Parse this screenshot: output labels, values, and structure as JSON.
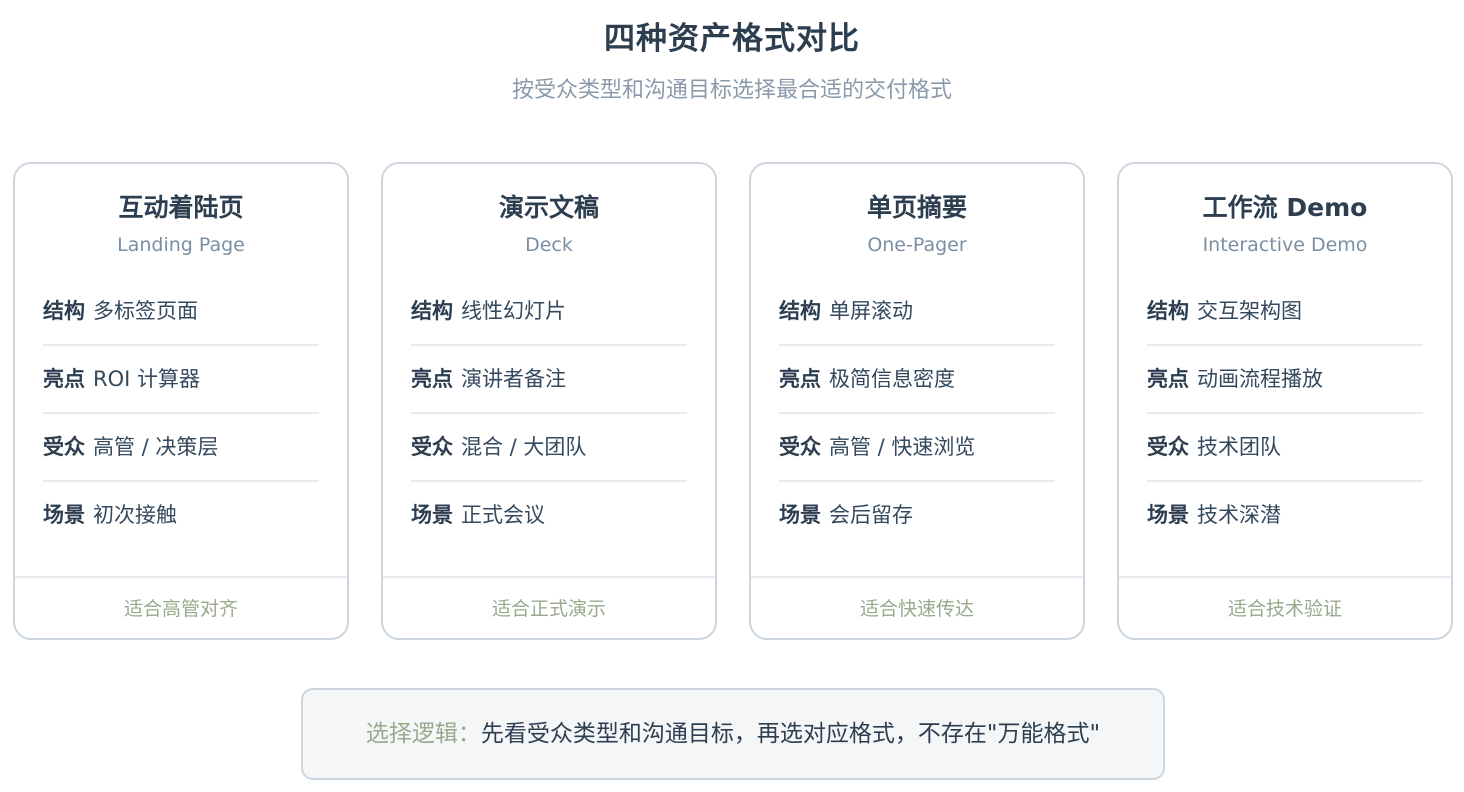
{
  "header": {
    "title": "四种资产格式对比",
    "subtitle": "按受众类型和沟通目标选择最合适的交付格式"
  },
  "cards": [
    {
      "title": "互动着陆页",
      "subtitle": "Landing Page",
      "rows": [
        {
          "key": "结构",
          "value": "多标签页面"
        },
        {
          "key": "亮点",
          "value": "ROI 计算器"
        },
        {
          "key": "受众",
          "value": "高管 / 决策层"
        },
        {
          "key": "场景",
          "value": "初次接触"
        }
      ],
      "footer": "适合高管对齐"
    },
    {
      "title": "演示文稿",
      "subtitle": "Deck",
      "rows": [
        {
          "key": "结构",
          "value": "线性幻灯片"
        },
        {
          "key": "亮点",
          "value": "演讲者备注"
        },
        {
          "key": "受众",
          "value": "混合 / 大团队"
        },
        {
          "key": "场景",
          "value": "正式会议"
        }
      ],
      "footer": "适合正式演示"
    },
    {
      "title": "单页摘要",
      "subtitle": "One-Pager",
      "rows": [
        {
          "key": "结构",
          "value": "单屏滚动"
        },
        {
          "key": "亮点",
          "value": "极简信息密度"
        },
        {
          "key": "受众",
          "value": "高管 / 快速浏览"
        },
        {
          "key": "场景",
          "value": "会后留存"
        }
      ],
      "footer": "适合快速传达"
    },
    {
      "title": "工作流 Demo",
      "subtitle": "Interactive Demo",
      "rows": [
        {
          "key": "结构",
          "value": "交互架构图"
        },
        {
          "key": "亮点",
          "value": "动画流程播放"
        },
        {
          "key": "受众",
          "value": "技术团队"
        },
        {
          "key": "场景",
          "value": "技术深潜"
        }
      ],
      "footer": "适合技术验证"
    }
  ],
  "note": {
    "label": "选择逻辑：",
    "text": "先看受众类型和沟通目标，再选对应格式，不存在\"万能格式\""
  },
  "colors": {
    "title": "#2c3e50",
    "subtitle": "#8a9aab",
    "card_border": "#cdd6e0",
    "accent_olive": "#9aa88c",
    "note_background": "#f4f6f8"
  }
}
